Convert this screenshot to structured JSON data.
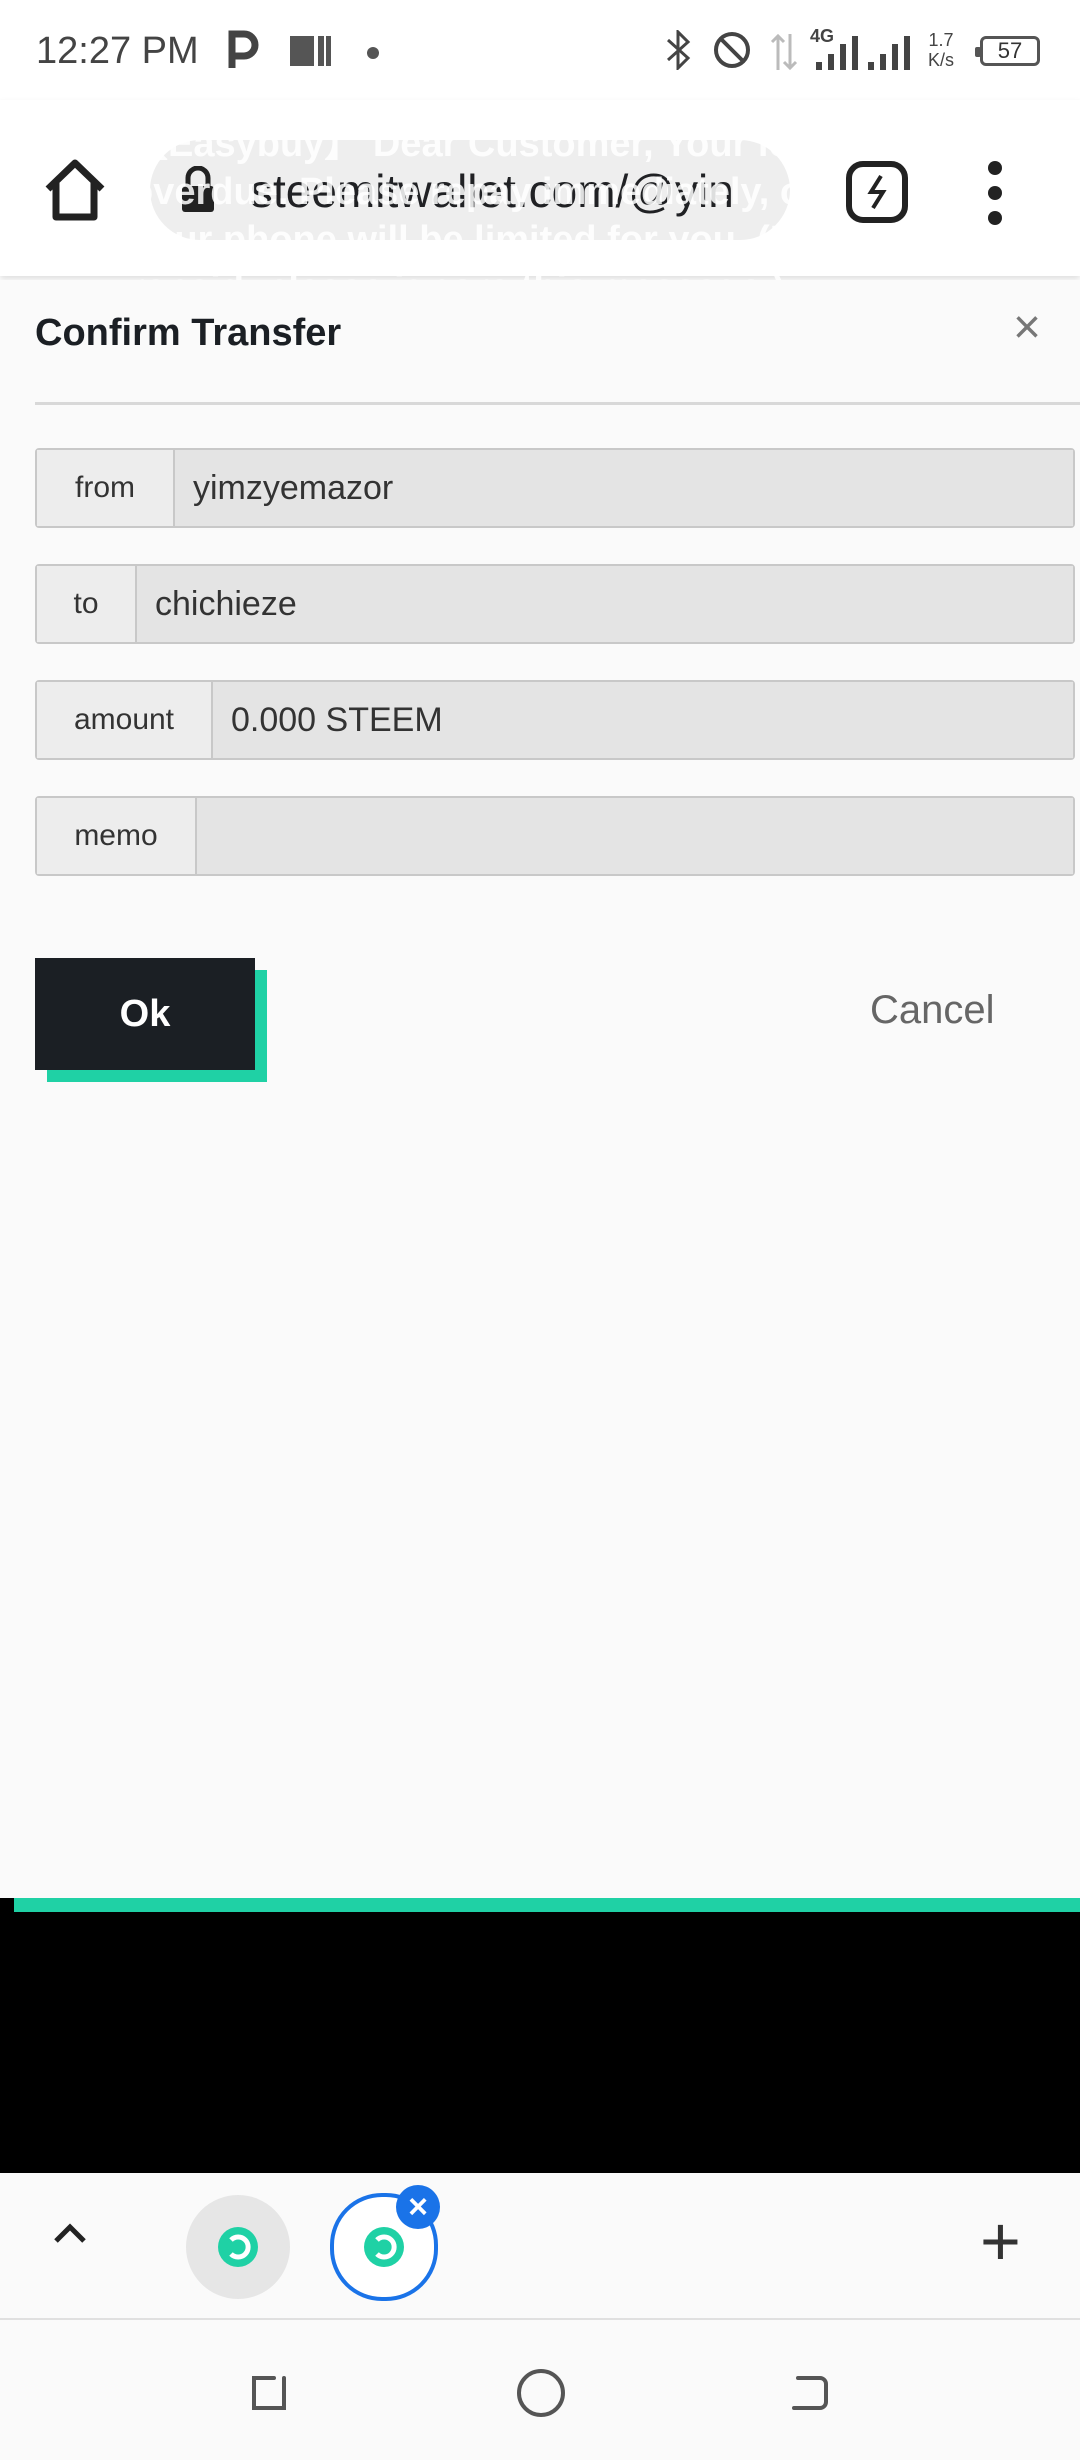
{
  "status_bar": {
    "time": "12:27 PM",
    "network_type": "4G",
    "speed_value": "1.7",
    "speed_unit": "K/s",
    "battery": "57"
  },
  "browser": {
    "url": "steemitwallet.com/@yin",
    "notification_text": "【Easybuy】 Dear Customer, Your loan is overdue. Please repay immediately, otherwise, your phone will be limited for you. (If you have repaid, please ignore this message.)"
  },
  "dialog": {
    "title": "Confirm Transfer",
    "close_icon": "close-icon",
    "fields": [
      {
        "label": "from",
        "value": "yimzyemazor"
      },
      {
        "label": "to",
        "value": "chichieze"
      },
      {
        "label": "amount",
        "value": "0.000 STEEM"
      },
      {
        "label": "memo",
        "value": ""
      }
    ],
    "ok_label": "Ok",
    "cancel_label": "Cancel"
  },
  "colors": {
    "accent": "#1fd1a5",
    "button_dark": "#1b1f24",
    "tab_active": "#1a73e8"
  }
}
